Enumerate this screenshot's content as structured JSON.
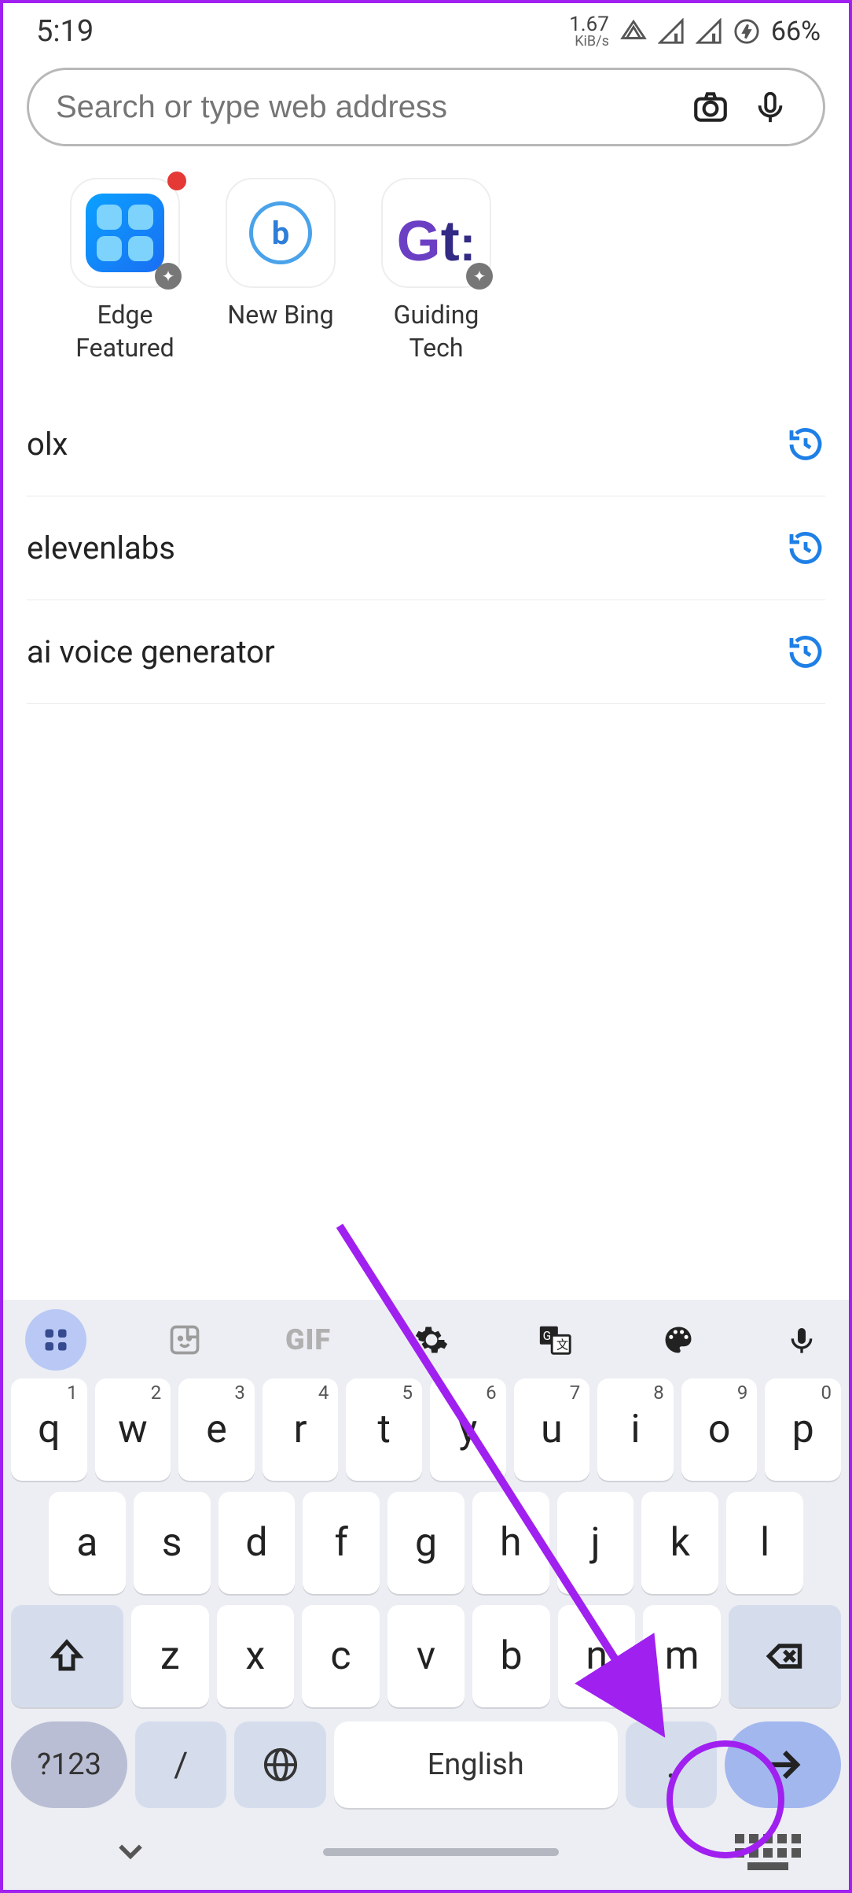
{
  "status": {
    "time": "5:19",
    "speed_top": "1.67",
    "speed_bot": "KiB/s",
    "battery": "66%"
  },
  "search": {
    "placeholder": "Search or type web address"
  },
  "shortcuts": [
    {
      "label": "Edge\nFeatured"
    },
    {
      "label": "New Bing"
    },
    {
      "label": "Guiding\nTech"
    }
  ],
  "history": [
    {
      "text": "olx"
    },
    {
      "text": "elevenlabs"
    },
    {
      "text": "ai voice generator"
    }
  ],
  "keyboard": {
    "gif": "GIF",
    "row1": [
      {
        "k": "q",
        "n": "1"
      },
      {
        "k": "w",
        "n": "2"
      },
      {
        "k": "e",
        "n": "3"
      },
      {
        "k": "r",
        "n": "4"
      },
      {
        "k": "t",
        "n": "5"
      },
      {
        "k": "y",
        "n": "6"
      },
      {
        "k": "u",
        "n": "7"
      },
      {
        "k": "i",
        "n": "8"
      },
      {
        "k": "o",
        "n": "9"
      },
      {
        "k": "p",
        "n": "0"
      }
    ],
    "row2": [
      "a",
      "s",
      "d",
      "f",
      "g",
      "h",
      "j",
      "k",
      "l"
    ],
    "row3": [
      "z",
      "x",
      "c",
      "v",
      "b",
      "n",
      "m"
    ],
    "sym": "?123",
    "slash": "/",
    "space": "English"
  }
}
